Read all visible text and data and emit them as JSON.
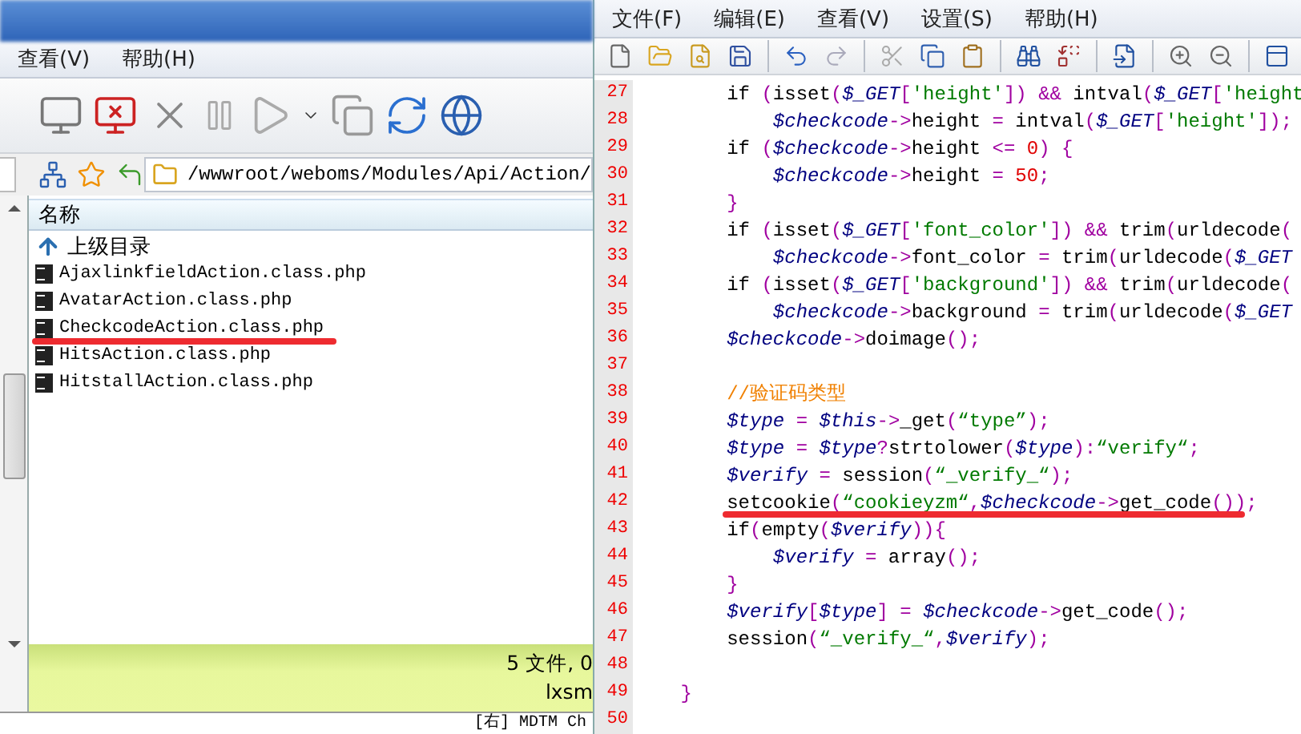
{
  "left_window": {
    "menu": [
      "查看(V)",
      "帮助(H)"
    ],
    "address": "/wwwroot/weboms/Modules/Api/Action/",
    "file_list": {
      "column": "名称",
      "items": [
        {
          "name": "上级目录",
          "kind": "parent",
          "underlined": false
        },
        {
          "name": "AjaxlinkfieldAction.class.php",
          "kind": "php",
          "underlined": false
        },
        {
          "name": "AvatarAction.class.php",
          "kind": "php",
          "underlined": false
        },
        {
          "name": "CheckcodeAction.class.php",
          "kind": "php",
          "underlined": true
        },
        {
          "name": "HitsAction.class.php",
          "kind": "php",
          "underlined": false
        },
        {
          "name": "HitstallAction.class.php",
          "kind": "php",
          "underlined": false
        }
      ]
    },
    "status": {
      "summary": "5 文件, 0",
      "user": "lxsm"
    },
    "log_line": "[右] MDTM Ch"
  },
  "editor": {
    "menu": [
      "文件(F)",
      "编辑(E)",
      "查看(V)",
      "设置(S)",
      "帮助(H)"
    ],
    "lines": [
      {
        "number": "27",
        "underlined": false,
        "tokens": [
          {
            "kind": "p",
            "text": "        if "
          },
          {
            "kind": "o",
            "text": "("
          },
          {
            "kind": "p",
            "text": "isset"
          },
          {
            "kind": "o",
            "text": "("
          },
          {
            "kind": "v",
            "text": "$_GET"
          },
          {
            "kind": "o",
            "text": "["
          },
          {
            "kind": "s",
            "text": "'height'"
          },
          {
            "kind": "o",
            "text": "]) &&"
          },
          {
            "kind": "p",
            "text": " intval"
          },
          {
            "kind": "o",
            "text": "("
          },
          {
            "kind": "v",
            "text": "$_GET"
          },
          {
            "kind": "o",
            "text": "["
          },
          {
            "kind": "s",
            "text": "'height"
          }
        ]
      },
      {
        "number": "28",
        "underlined": false,
        "tokens": [
          {
            "kind": "v",
            "text": "            $checkcode"
          },
          {
            "kind": "o",
            "text": "->"
          },
          {
            "kind": "p",
            "text": "height "
          },
          {
            "kind": "o",
            "text": "="
          },
          {
            "kind": "p",
            "text": " intval"
          },
          {
            "kind": "o",
            "text": "("
          },
          {
            "kind": "v",
            "text": "$_GET"
          },
          {
            "kind": "o",
            "text": "["
          },
          {
            "kind": "s",
            "text": "'height'"
          },
          {
            "kind": "o",
            "text": "]);"
          }
        ]
      },
      {
        "number": "29",
        "underlined": false,
        "tokens": [
          {
            "kind": "p",
            "text": "        if "
          },
          {
            "kind": "o",
            "text": "("
          },
          {
            "kind": "v",
            "text": "$checkcode"
          },
          {
            "kind": "o",
            "text": "->"
          },
          {
            "kind": "p",
            "text": "height "
          },
          {
            "kind": "o",
            "text": "<= "
          },
          {
            "kind": "n",
            "text": "0"
          },
          {
            "kind": "o",
            "text": ") {"
          }
        ]
      },
      {
        "number": "30",
        "underlined": false,
        "tokens": [
          {
            "kind": "v",
            "text": "            $checkcode"
          },
          {
            "kind": "o",
            "text": "->"
          },
          {
            "kind": "p",
            "text": "height "
          },
          {
            "kind": "o",
            "text": "= "
          },
          {
            "kind": "n",
            "text": "50"
          },
          {
            "kind": "o",
            "text": ";"
          }
        ]
      },
      {
        "number": "31",
        "underlined": false,
        "tokens": [
          {
            "kind": "o",
            "text": "        }"
          }
        ]
      },
      {
        "number": "32",
        "underlined": false,
        "tokens": [
          {
            "kind": "p",
            "text": "        if "
          },
          {
            "kind": "o",
            "text": "("
          },
          {
            "kind": "p",
            "text": "isset"
          },
          {
            "kind": "o",
            "text": "("
          },
          {
            "kind": "v",
            "text": "$_GET"
          },
          {
            "kind": "o",
            "text": "["
          },
          {
            "kind": "s",
            "text": "'font_color'"
          },
          {
            "kind": "o",
            "text": "]) &&"
          },
          {
            "kind": "p",
            "text": " trim"
          },
          {
            "kind": "o",
            "text": "("
          },
          {
            "kind": "p",
            "text": "urldecode"
          },
          {
            "kind": "o",
            "text": "("
          }
        ]
      },
      {
        "number": "33",
        "underlined": false,
        "tokens": [
          {
            "kind": "v",
            "text": "            $checkcode"
          },
          {
            "kind": "o",
            "text": "->"
          },
          {
            "kind": "p",
            "text": "font_color "
          },
          {
            "kind": "o",
            "text": "="
          },
          {
            "kind": "p",
            "text": " trim"
          },
          {
            "kind": "o",
            "text": "("
          },
          {
            "kind": "p",
            "text": "urldecode"
          },
          {
            "kind": "o",
            "text": "("
          },
          {
            "kind": "v",
            "text": "$_GET"
          }
        ]
      },
      {
        "number": "34",
        "underlined": false,
        "tokens": [
          {
            "kind": "p",
            "text": "        if "
          },
          {
            "kind": "o",
            "text": "("
          },
          {
            "kind": "p",
            "text": "isset"
          },
          {
            "kind": "o",
            "text": "("
          },
          {
            "kind": "v",
            "text": "$_GET"
          },
          {
            "kind": "o",
            "text": "["
          },
          {
            "kind": "s",
            "text": "'background'"
          },
          {
            "kind": "o",
            "text": "]) &&"
          },
          {
            "kind": "p",
            "text": " trim"
          },
          {
            "kind": "o",
            "text": "("
          },
          {
            "kind": "p",
            "text": "urldecode"
          },
          {
            "kind": "o",
            "text": "("
          }
        ]
      },
      {
        "number": "35",
        "underlined": false,
        "tokens": [
          {
            "kind": "v",
            "text": "            $checkcode"
          },
          {
            "kind": "o",
            "text": "->"
          },
          {
            "kind": "p",
            "text": "background "
          },
          {
            "kind": "o",
            "text": "="
          },
          {
            "kind": "p",
            "text": " trim"
          },
          {
            "kind": "o",
            "text": "("
          },
          {
            "kind": "p",
            "text": "urldecode"
          },
          {
            "kind": "o",
            "text": "("
          },
          {
            "kind": "v",
            "text": "$_GET"
          }
        ]
      },
      {
        "number": "36",
        "underlined": false,
        "tokens": [
          {
            "kind": "v",
            "text": "        $checkcode"
          },
          {
            "kind": "o",
            "text": "->"
          },
          {
            "kind": "p",
            "text": "doimage"
          },
          {
            "kind": "o",
            "text": "();"
          }
        ]
      },
      {
        "number": "37",
        "underlined": false
      },
      {
        "number": "38",
        "underlined": false,
        "tokens": [
          {
            "kind": "c",
            "text": "        //验证码类型"
          }
        ]
      },
      {
        "number": "39",
        "underlined": false,
        "tokens": [
          {
            "kind": "v",
            "text": "        $type"
          },
          {
            "kind": "o",
            "text": " = "
          },
          {
            "kind": "v",
            "text": "$this"
          },
          {
            "kind": "o",
            "text": "->"
          },
          {
            "kind": "p",
            "text": "_get"
          },
          {
            "kind": "o",
            "text": "("
          },
          {
            "kind": "s",
            "text": "“type”"
          },
          {
            "kind": "o",
            "text": ");"
          }
        ]
      },
      {
        "number": "40",
        "underlined": false,
        "tokens": [
          {
            "kind": "v",
            "text": "        $type"
          },
          {
            "kind": "o",
            "text": " = "
          },
          {
            "kind": "v",
            "text": "$type"
          },
          {
            "kind": "o",
            "text": "?"
          },
          {
            "kind": "p",
            "text": "strtolower"
          },
          {
            "kind": "o",
            "text": "("
          },
          {
            "kind": "v",
            "text": "$type"
          },
          {
            "kind": "o",
            "text": "):"
          },
          {
            "kind": "s",
            "text": "“verify“"
          },
          {
            "kind": "o",
            "text": ";"
          }
        ]
      },
      {
        "number": "41",
        "underlined": false,
        "tokens": [
          {
            "kind": "v",
            "text": "        $verify"
          },
          {
            "kind": "o",
            "text": " ="
          },
          {
            "kind": "p",
            "text": " session"
          },
          {
            "kind": "o",
            "text": "("
          },
          {
            "kind": "s",
            "text": "“_verify_“"
          },
          {
            "kind": "o",
            "text": ");"
          }
        ]
      },
      {
        "number": "42",
        "underlined": true,
        "tokens": [
          {
            "kind": "p",
            "text": "        setcookie"
          },
          {
            "kind": "o",
            "text": "("
          },
          {
            "kind": "s",
            "text": "“cookieyzm“"
          },
          {
            "kind": "o",
            "text": ","
          },
          {
            "kind": "v",
            "text": "$checkcode"
          },
          {
            "kind": "o",
            "text": "->"
          },
          {
            "kind": "p",
            "text": "get_code"
          },
          {
            "kind": "o",
            "text": "());"
          }
        ]
      },
      {
        "number": "43",
        "underlined": false,
        "tokens": [
          {
            "kind": "p",
            "text": "        if"
          },
          {
            "kind": "o",
            "text": "("
          },
          {
            "kind": "p",
            "text": "empty"
          },
          {
            "kind": "o",
            "text": "("
          },
          {
            "kind": "v",
            "text": "$verify"
          },
          {
            "kind": "o",
            "text": ")){"
          }
        ]
      },
      {
        "number": "44",
        "underlined": false,
        "tokens": [
          {
            "kind": "v",
            "text": "            $verify"
          },
          {
            "kind": "o",
            "text": " ="
          },
          {
            "kind": "p",
            "text": " array"
          },
          {
            "kind": "o",
            "text": "();"
          }
        ]
      },
      {
        "number": "45",
        "underlined": false,
        "tokens": [
          {
            "kind": "o",
            "text": "        }"
          }
        ]
      },
      {
        "number": "46",
        "underlined": false,
        "tokens": [
          {
            "kind": "v",
            "text": "        $verify"
          },
          {
            "kind": "o",
            "text": "["
          },
          {
            "kind": "v",
            "text": "$type"
          },
          {
            "kind": "o",
            "text": "] = "
          },
          {
            "kind": "v",
            "text": "$checkcode"
          },
          {
            "kind": "o",
            "text": "->"
          },
          {
            "kind": "p",
            "text": "get_code"
          },
          {
            "kind": "o",
            "text": "();"
          }
        ]
      },
      {
        "number": "47",
        "underlined": false,
        "tokens": [
          {
            "kind": "p",
            "text": "        session"
          },
          {
            "kind": "o",
            "text": "("
          },
          {
            "kind": "s",
            "text": "“_verify_“"
          },
          {
            "kind": "o",
            "text": ","
          },
          {
            "kind": "v",
            "text": "$verify"
          },
          {
            "kind": "o",
            "text": ");"
          }
        ]
      },
      {
        "number": "48",
        "underlined": false
      },
      {
        "number": "49",
        "underlined": false,
        "tokens": [
          {
            "kind": "o",
            "text": "    }"
          }
        ]
      },
      {
        "number": "50",
        "underlined": false
      }
    ]
  }
}
